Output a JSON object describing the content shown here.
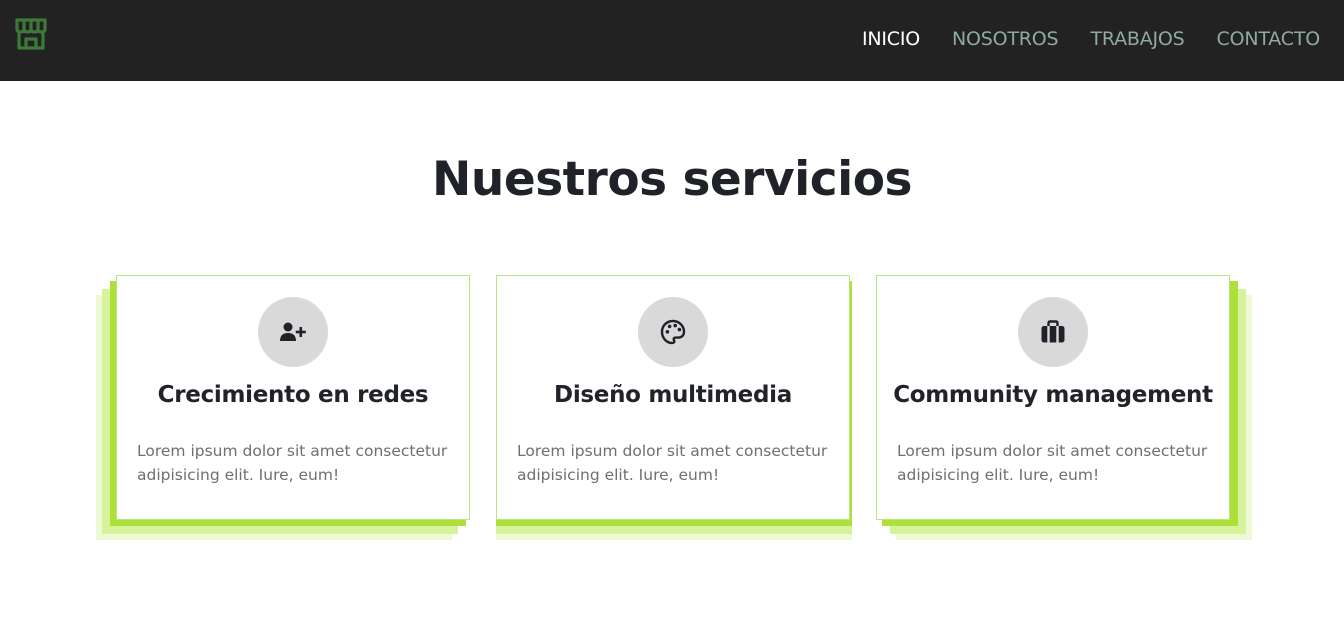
{
  "nav": {
    "logo_icon": "store-icon",
    "items": [
      {
        "label": "INICIO",
        "active": true
      },
      {
        "label": "NOSOTROS",
        "active": false
      },
      {
        "label": "TRABAJOS",
        "active": false
      },
      {
        "label": "CONTACTO",
        "active": false
      }
    ]
  },
  "services": {
    "title": "Nuestros servicios",
    "cards": [
      {
        "icon": "user-plus-icon",
        "title": "Crecimiento en redes",
        "text": "Lorem ipsum dolor sit amet consectetur adipisicing elit. Iure, eum!"
      },
      {
        "icon": "palette-icon",
        "title": "Diseño multimedia",
        "text": "Lorem ipsum dolor sit amet consectetur adipisicing elit. Iure, eum!"
      },
      {
        "icon": "briefcase-icon",
        "title": "Community management",
        "text": "Lorem ipsum dolor sit amet consectetur adipisicing elit. Iure, eum!"
      }
    ]
  },
  "colors": {
    "nav_background": "#222222",
    "nav_link": "#8eaaa2",
    "nav_link_active": "#ffffff",
    "logo": "#3d7a3a",
    "accent_green": "#aee03a",
    "card_border": "#b9e585",
    "icon_circle": "#d9d9d9"
  }
}
